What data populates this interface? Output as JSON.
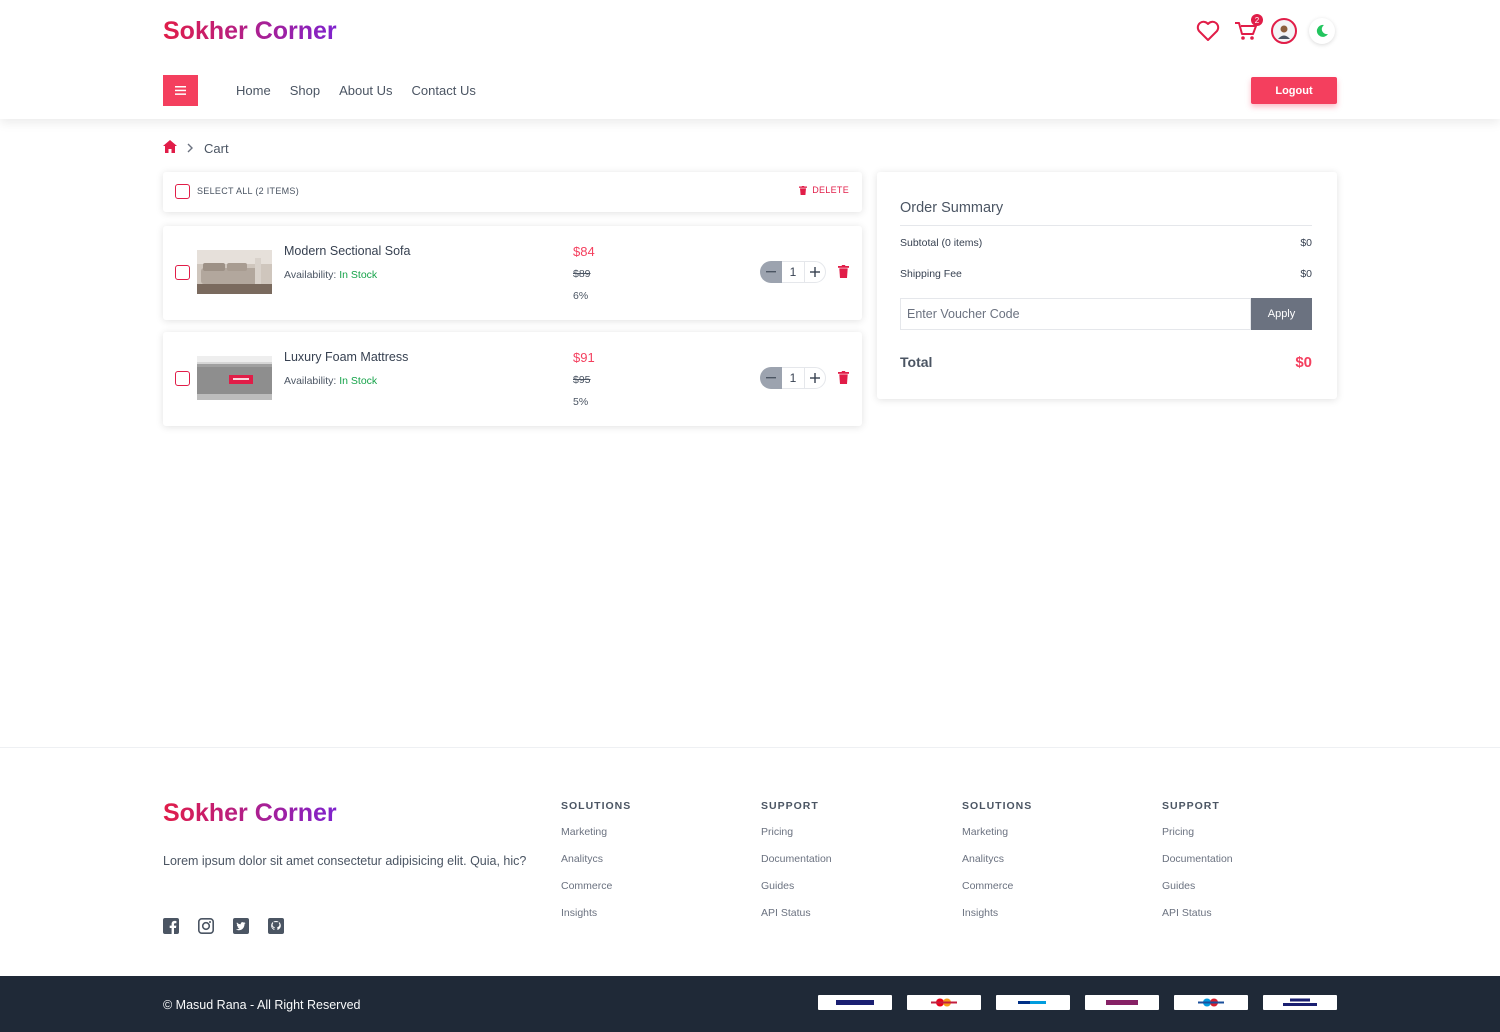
{
  "header": {
    "brand": "Sokher Corner",
    "cart_count": "2",
    "nav": [
      "Home",
      "Shop",
      "About Us",
      "Contact Us"
    ],
    "logout_label": "Logout"
  },
  "breadcrumb": {
    "current": "Cart"
  },
  "cart": {
    "select_all_label": "SELECT ALL (2 ITEMS)",
    "delete_label": "DELETE",
    "availability_label": "Availability: ",
    "items": [
      {
        "name": "Modern Sectional Sofa",
        "stock": "In Stock",
        "price": "$84",
        "old_price": "$89",
        "discount": "6%",
        "qty": "1"
      },
      {
        "name": "Luxury Foam Mattress",
        "stock": "In Stock",
        "price": "$91",
        "old_price": "$95",
        "discount": "5%",
        "qty": "1"
      }
    ]
  },
  "summary": {
    "title": "Order Summary",
    "subtotal_label": "Subtotal (0 items)",
    "subtotal_value": "$0",
    "shipping_label": "Shipping Fee",
    "shipping_value": "$0",
    "voucher_placeholder": "Enter Voucher Code",
    "apply_label": "Apply",
    "total_label": "Total",
    "total_value": "$0"
  },
  "footer": {
    "brand": "Sokher Corner",
    "description": "Lorem ipsum dolor sit amet consectetur adipisicing elit. Quia, hic?",
    "columns": [
      {
        "title": "SOLUTIONS",
        "links": [
          "Marketing",
          "Analitycs",
          "Commerce",
          "Insights"
        ]
      },
      {
        "title": "SUPPORT",
        "links": [
          "Pricing",
          "Documentation",
          "Guides",
          "API Status"
        ]
      },
      {
        "title": "SOLUTIONS",
        "links": [
          "Marketing",
          "Analitycs",
          "Commerce",
          "Insights"
        ]
      },
      {
        "title": "SUPPORT",
        "links": [
          "Pricing",
          "Documentation",
          "Guides",
          "API Status"
        ]
      }
    ],
    "copyright": "© Masud Rana - All Right Reserved",
    "payment_icons": [
      "visa-icon",
      "mastercard-icon",
      "paypal-icon",
      "skrill-icon",
      "maestro-icon",
      "visa-electron-icon"
    ]
  },
  "colors": {
    "accent": "#f43f5e",
    "brand_start": "#e11d48",
    "brand_end": "#7e22ce",
    "in_stock": "#16a34a",
    "footer_bar": "#1f2937"
  }
}
